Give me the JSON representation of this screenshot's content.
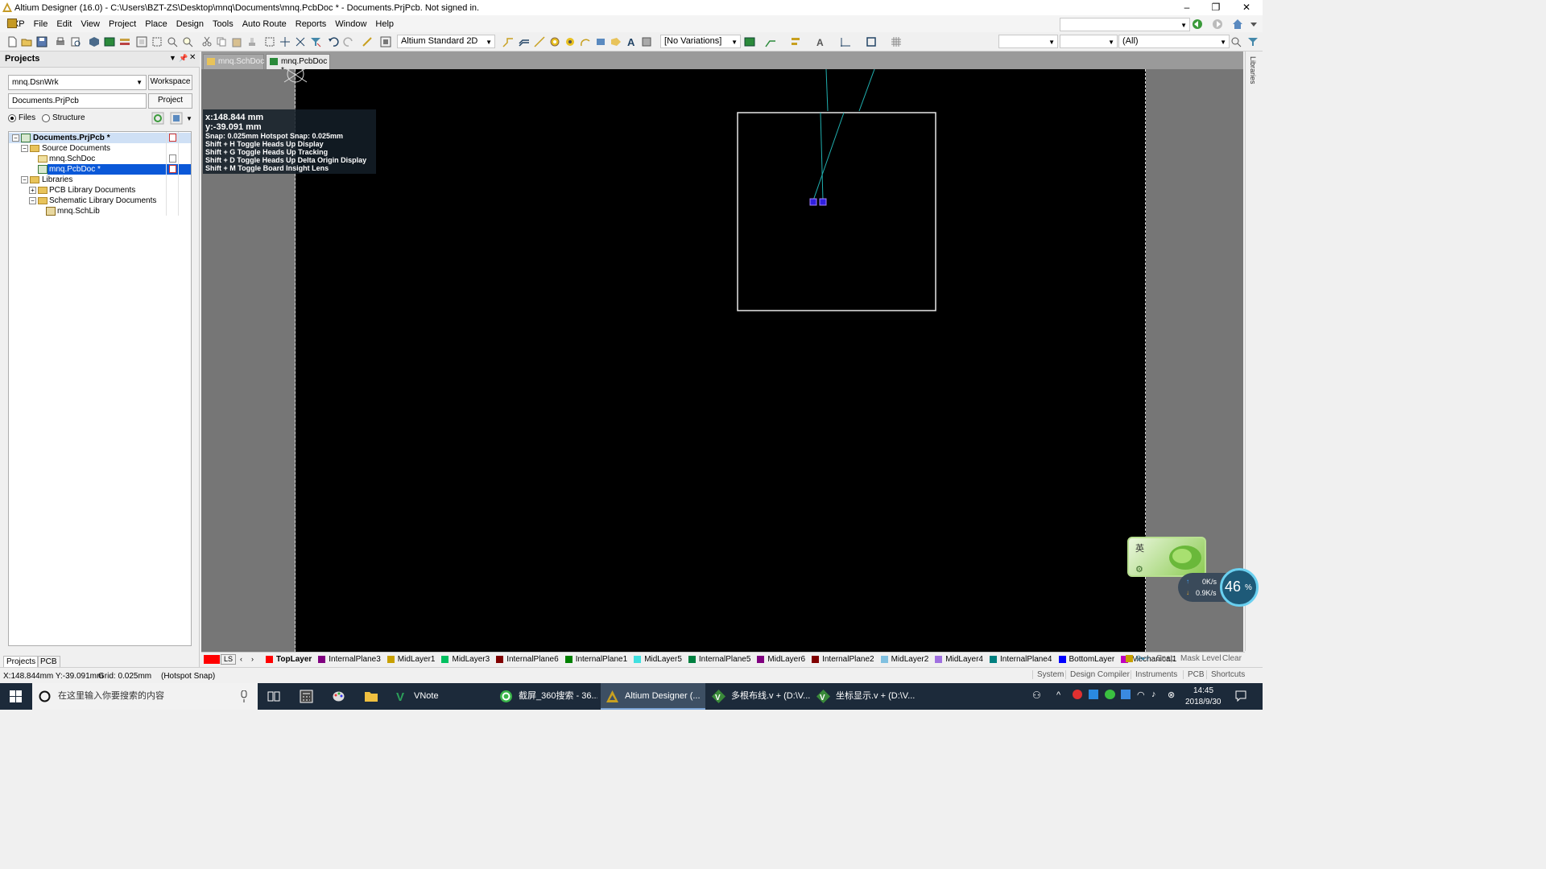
{
  "window": {
    "title": "Altium Designer (16.0) - C:\\Users\\BZT-ZS\\Desktop\\mnq\\Documents\\mnq.PcbDoc * - Documents.PrjPcb. Not signed in.",
    "minimize": "–",
    "maximize": "❐",
    "close": "✕"
  },
  "menu": [
    "DXP",
    "File",
    "Edit",
    "View",
    "Project",
    "Place",
    "Design",
    "Tools",
    "Auto Route",
    "Reports",
    "Window",
    "Help"
  ],
  "toolbar": {
    "view_mode": "Altium Standard 2D",
    "variations": "[No Variations]",
    "filter_all": "(All)"
  },
  "panel": {
    "title": "Projects",
    "workspace_value": "mnq.DsnWrk",
    "workspace_btn": "Workspace",
    "project_value": "Documents.PrjPcb",
    "project_btn": "Project",
    "radio_files": "Files",
    "radio_structure": "Structure",
    "tree": [
      {
        "label": "Documents.PrjPcb *"
      },
      {
        "label": "Source Documents"
      },
      {
        "label": "mnq.SchDoc"
      },
      {
        "label": "mnq.PcbDoc *"
      },
      {
        "label": "Libraries"
      },
      {
        "label": "PCB Library Documents"
      },
      {
        "label": "Schematic Library Documents"
      },
      {
        "label": "mnq.SchLib"
      }
    ],
    "tabs": [
      "Projects",
      "PCB"
    ]
  },
  "doc_tabs": [
    "mnq.SchDoc",
    "mnq.PcbDoc *"
  ],
  "hud": {
    "x": "x:148.844 mm",
    "y": "y:-39.091  mm",
    "snap": "Snap: 0.025mm Hotspot Snap: 0.025mm",
    "lines": [
      "Shift + H  Toggle Heads Up Display",
      "Shift + G  Toggle Heads Up Tracking",
      "Shift + D  Toggle Heads Up Delta Origin Display",
      "Shift + M  Toggle Board Insight Lens"
    ]
  },
  "right_strip_label": "Libraries",
  "layers": [
    {
      "name": "LS",
      "color": "#ff0000"
    },
    {
      "name": "TopLayer",
      "color": "#ff0000"
    },
    {
      "name": "InternalPlane3",
      "color": "#800080"
    },
    {
      "name": "MidLayer1",
      "color": "#c8a000"
    },
    {
      "name": "MidLayer3",
      "color": "#00c060"
    },
    {
      "name": "InternalPlane6",
      "color": "#800000"
    },
    {
      "name": "InternalPlane1",
      "color": "#008000"
    },
    {
      "name": "MidLayer5",
      "color": "#40e0e0"
    },
    {
      "name": "InternalPlane5",
      "color": "#008040"
    },
    {
      "name": "MidLayer6",
      "color": "#800080"
    },
    {
      "name": "InternalPlane2",
      "color": "#800000"
    },
    {
      "name": "MidLayer2",
      "color": "#80c0e0"
    },
    {
      "name": "MidLayer4",
      "color": "#a070e0"
    },
    {
      "name": "InternalPlane4",
      "color": "#008080"
    },
    {
      "name": "BottomLayer",
      "color": "#0000ff"
    },
    {
      "name": "Mechanical1",
      "color": "#c000c0"
    }
  ],
  "layer_buttons": [
    "Snap",
    "Mask Level",
    "Clear"
  ],
  "status": {
    "coords": "X:148.844mm Y:-39.091mm",
    "grid": "Grid: 0.025mm",
    "snap": "(Hotspot Snap)",
    "buttons": [
      "System",
      "Design Compiler",
      "Instruments",
      "PCB",
      "Shortcuts"
    ]
  },
  "taskbar": {
    "search_placeholder": "在这里输入你要搜索的内容",
    "items": [
      {
        "label": "VNote",
        "color": "#2ca05a"
      },
      {
        "label": "截屏_360搜索 - 36...",
        "color": "#3ab54a"
      },
      {
        "label": "Altium Designer (...",
        "color": "#c8a020"
      },
      {
        "label": "多根布线.v + (D:\\V...",
        "color": "#3a8a3a"
      },
      {
        "label": "坐标显示.v + (D:\\V...",
        "color": "#3a8a3a"
      }
    ],
    "time": "14:45",
    "date": "2018/9/30"
  },
  "widgets": {
    "ime": "英",
    "up_speed": "0K/s",
    "down_speed": "0.9K/s",
    "percent": "46",
    "percent_sign": "%"
  }
}
